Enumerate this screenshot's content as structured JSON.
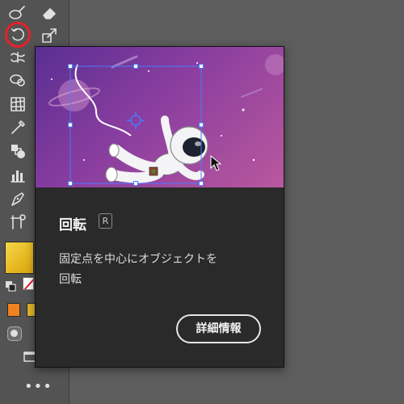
{
  "toolbar": {
    "tools": [
      {
        "name": "blob-brush-tool",
        "icon": "blob-brush-icon"
      },
      {
        "name": "eraser-tool",
        "icon": "eraser-icon"
      },
      {
        "name": "rotate-tool",
        "icon": "rotate-icon",
        "selected": true,
        "highlight_color": "#e8202a"
      },
      {
        "name": "scale-tool",
        "icon": "scale-icon"
      },
      {
        "name": "width-tool",
        "icon": "width-icon"
      },
      {
        "name": "shape-builder-tool",
        "icon": "shape-builder-icon"
      },
      {
        "name": "perspective-grid-tool",
        "icon": "perspective-grid-icon"
      },
      {
        "name": "eyedropper-tool",
        "icon": "eyedropper-icon"
      },
      {
        "name": "blend-tool",
        "icon": "blend-icon"
      },
      {
        "name": "graph-tool",
        "icon": "column-graph-icon"
      },
      {
        "name": "pen-tool",
        "icon": "pen-icon"
      },
      {
        "name": "artboard-tool",
        "icon": "artboard-icon"
      }
    ],
    "fill_color": "#e5b820",
    "stroke": "none",
    "swatches": [
      "#f0821e",
      "#e3b52c"
    ],
    "more_label": "•••"
  },
  "tooltip": {
    "title": "回転",
    "shortcut": "R",
    "description": "固定点を中心にオブジェクトを\n回転",
    "learn_more_label": "詳細情報",
    "preview": {
      "subject": "astronaut",
      "background_colors": [
        "#5a2e92",
        "#b9589e"
      ],
      "selection_color": "#4a7bff"
    }
  }
}
